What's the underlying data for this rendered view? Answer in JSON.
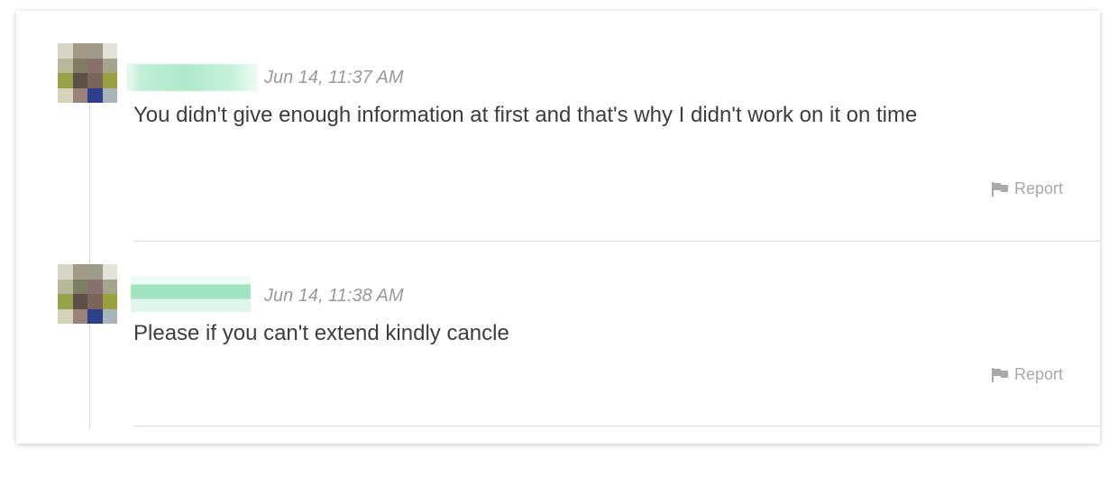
{
  "messages": [
    {
      "author_name": "",
      "timestamp": "Jun 14, 11:37 AM",
      "text": "You didn't give enough information at first and that's why I didn't work on it on time",
      "report_label": "Report",
      "report_icon": "flag-icon"
    },
    {
      "author_name": "",
      "timestamp": "Jun 14, 11:38 AM",
      "text": "Please if you can't extend kindly cancle",
      "report_label": "Report",
      "report_icon": "flag-icon"
    }
  ],
  "colors": {
    "timestamp": "#9a9a9a",
    "message_text": "#3d3d3d",
    "report": "#a9a9a9",
    "name_redaction": "#aee9cc"
  }
}
